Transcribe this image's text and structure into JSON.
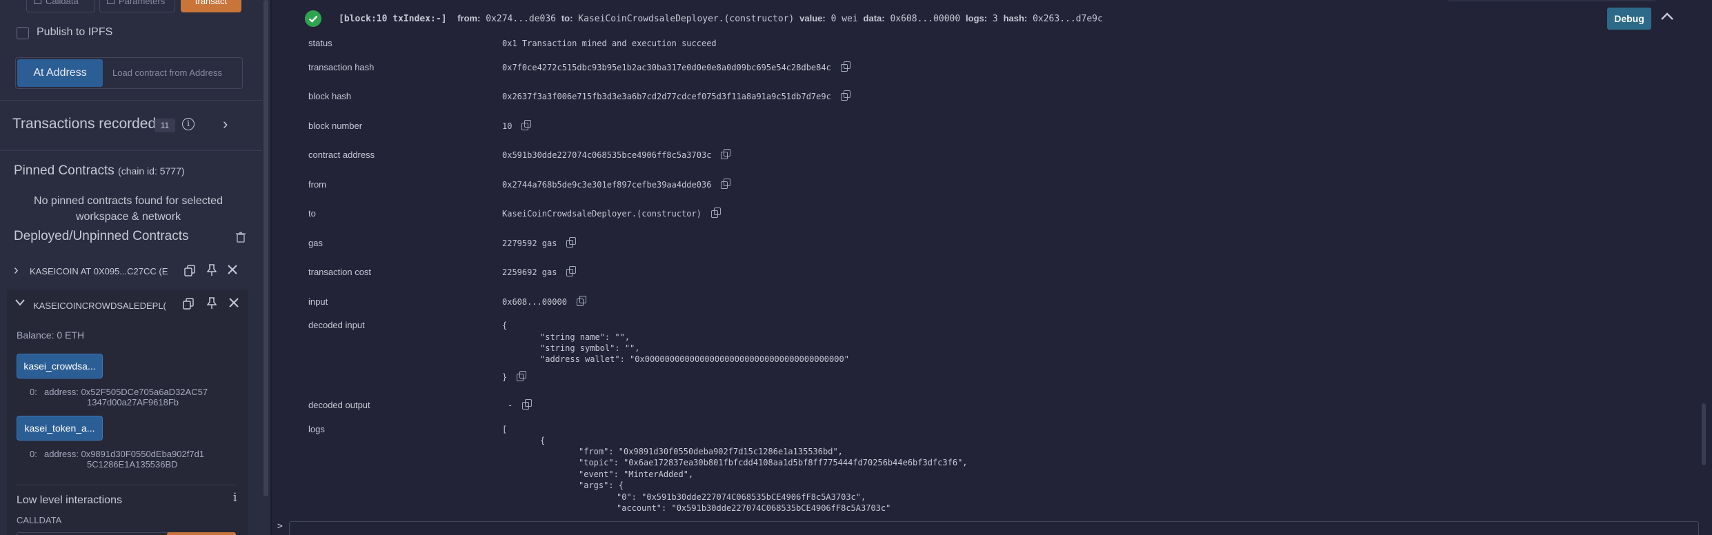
{
  "sidebar": {
    "top_buttons": {
      "calldata": "Calldata",
      "parameters": "Parameters",
      "transact": "transact"
    },
    "publish_ipfs": "Publish to IPFS",
    "at_address": "At Address",
    "load_placeholder": "Load contract from Address",
    "transactions_recorded": "Transactions recorded",
    "transactions_count": "11",
    "pinned_title": "Pinned Contracts",
    "pinned_chain": "(chain id: 5777)",
    "no_pinned": "No pinned contracts found for selected workspace & network",
    "deployed_title": "Deployed/Unpinned Contracts",
    "contract1": "KASEICOIN AT 0X095...C27CC (E",
    "contract2": "KASEICOINCROWDSALEDEPL(",
    "balance": "Balance: 0 ETH",
    "fn1_label": "kasei_crowdsa...",
    "fn1_out_idx": "0:",
    "fn1_out_line1": "address: 0x52F505DCe705a6aD32AC57",
    "fn1_out_line2": "1347d00a27AF9618Fb",
    "fn2_label": "kasei_token_a...",
    "fn2_out_idx": "0:",
    "fn2_out_line1": "address: 0x9891d30F0550dEba902f7d1",
    "fn2_out_line2": "5C1286E1A135536BD",
    "low_level": "Low level interactions",
    "calldata_label": "CALLDATA"
  },
  "tx_header": {
    "block": "[block:10 txIndex:-]",
    "from_label": "from:",
    "from_val": "0x274...de036",
    "to_label": "to:",
    "to_val": "KaseiCoinCrowdsaleDeployer.(constructor)",
    "value_label": "value:",
    "value_val": "0 wei",
    "data_label": "data:",
    "data_val": "0x608...00000",
    "logs_label": "logs:",
    "logs_val": "3",
    "hash_label": "hash:",
    "hash_val": "0x263...d7e9c",
    "debug": "Debug"
  },
  "tx_rows": {
    "status": {
      "key": "status",
      "val": "0x1 Transaction mined and execution succeed"
    },
    "tx_hash": {
      "key": "transaction hash",
      "val": "0x7f0ce4272c515dbc93b95e1b2ac30ba317e0d0e0e8a0d09bc695e54c28dbe84c"
    },
    "block_hash": {
      "key": "block hash",
      "val": "0x2637f3a3f006e715fb3d3e3a6b7cd2d77cdcef075d3f11a8a91a9c51db7d7e9c"
    },
    "block_number": {
      "key": "block number",
      "val": "10"
    },
    "contract_address": {
      "key": "contract address",
      "val": "0x591b30dde227074c068535bce4906ff8c5a3703c"
    },
    "from": {
      "key": "from",
      "val": "0x2744a768b5de9c3e301ef897cefbe39aa4dde036"
    },
    "to": {
      "key": "to",
      "val": "KaseiCoinCrowdsaleDeployer.(constructor)"
    },
    "gas": {
      "key": "gas",
      "val": "2279592 gas"
    },
    "tx_cost": {
      "key": "transaction cost",
      "val": "2259692 gas"
    },
    "input": {
      "key": "input",
      "val": "0x608...00000"
    },
    "decoded_input": {
      "key": "decoded input",
      "open": "{",
      "l1": "\"string name\": \"\",",
      "l2": "\"string symbol\": \"\",",
      "l3": "\"address wallet\": \"0x0000000000000000000000000000000000000000\"",
      "close": "}"
    },
    "decoded_output": {
      "key": "decoded output",
      "val": "-"
    },
    "logs": {
      "key": "logs",
      "open": "[",
      "brace": "{",
      "from": "\"from\": \"0x9891d30f0550deba902f7d15c1286e1a135536bd\",",
      "topic": "\"topic\": \"0x6ae172837ea30b801fbfcdd4108aa1d5bf8ff775444fd70256b44e6bf3dfc3f6\",",
      "event": "\"event\": \"MinterAdded\",",
      "args": "\"args\": {",
      "arg0": "\"0\": \"0x591b30dde227074C068535bCE4906fF8c5A3703c\",",
      "account": "\"account\": \"0x591b30dde227074C068535bCE4906fF8c5A3703c\""
    }
  },
  "terminal_prompt": ">"
}
